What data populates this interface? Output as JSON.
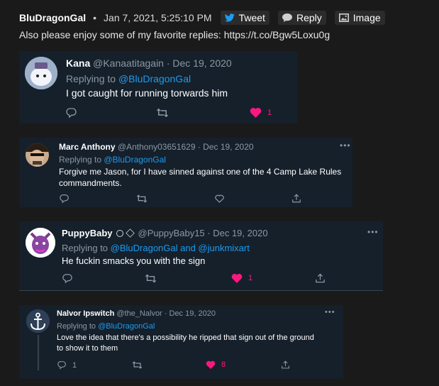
{
  "header": {
    "author": "BluDragonGal",
    "separator": "•",
    "date": "Jan 7, 2021, 5:25:10 PM",
    "tweet_label": "Tweet",
    "reply_label": "Reply",
    "image_label": "Image"
  },
  "main_text": "Also please enjoy some of my favorite replies: https://t.co/Bgw5Loxu0g",
  "replies": [
    {
      "name": "Kana",
      "handle": "@Kanaatitagain · Dec 19, 2020",
      "replying_prefix": "Replying to ",
      "replying_to": "@BluDragonGal",
      "text": "I got caught for running torwards him",
      "like_count": "1"
    },
    {
      "name": "Marc Anthony",
      "handle": "@Anthony03651629 · Dec 19, 2020",
      "replying_prefix": "Replying to ",
      "replying_to": "@BluDragonGal",
      "text_line1": "Forgive me Jason, for I have sinned against one of the 4 Camp Lake Rules",
      "text_line2": "commandments.",
      "more": "•••"
    },
    {
      "name": "PuppyBaby",
      "handle": "@PuppyBaby15 · Dec 19, 2020",
      "replying_prefix": "Replying to ",
      "replying_to": "@BluDragonGal and @junkmixart",
      "text": "He fuckin smacks you with the sign",
      "like_count": "1",
      "more": "•••"
    },
    {
      "name": "Nalvor Ipswitch",
      "handle": "@the_Nalvor · Dec 19, 2020",
      "replying_prefix": "Replying to ",
      "replying_to": "@BluDragonGal",
      "text_line1": "Love the idea that there's a possibility he ripped that sign out of the ground",
      "text_line2": "to show it to them",
      "reply_count": "1",
      "like_count": "8",
      "more": "•••"
    }
  ],
  "colors": {
    "background": "#1a1a1a",
    "card": "#15202b",
    "link": "#1d9bf0",
    "muted": "#8b98a5",
    "like": "#f91880",
    "tweet_bird": "#1d9bf0"
  }
}
